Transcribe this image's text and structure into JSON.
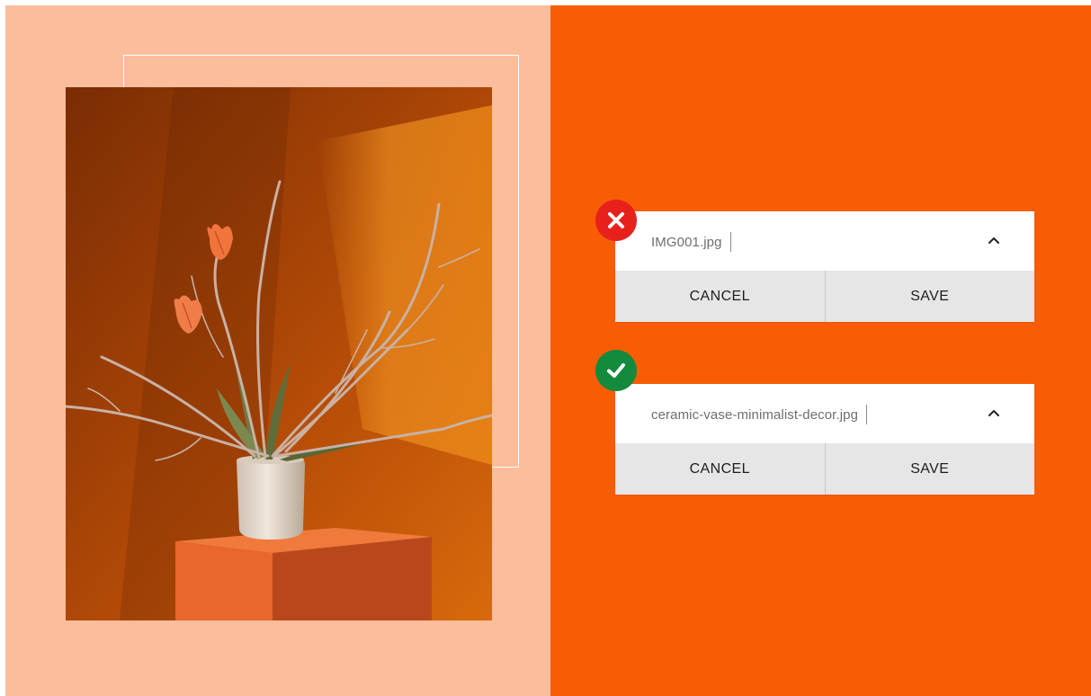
{
  "photo": {
    "subject": "tulip branches in ceramic vase on orange pedestal",
    "palette": {
      "wall_dark": "#7a2c04",
      "wall_light": "#e0770c",
      "pedestal": "#e9662c",
      "vase": "#e8dcd1",
      "tulip": "#f0743c"
    }
  },
  "colors": {
    "left_panel": "#fbbd9b",
    "right_panel": "#f85d06",
    "error_badge": "#e8201b",
    "success_badge": "#138a3c"
  },
  "examples": [
    {
      "status": "error",
      "status_icon": "close-icon",
      "filename": "IMG001.jpg",
      "cancel_label": "CANCEL",
      "save_label": "SAVE"
    },
    {
      "status": "success",
      "status_icon": "check-icon",
      "filename": "ceramic-vase-minimalist-decor.jpg",
      "cancel_label": "CANCEL",
      "save_label": "SAVE"
    }
  ]
}
